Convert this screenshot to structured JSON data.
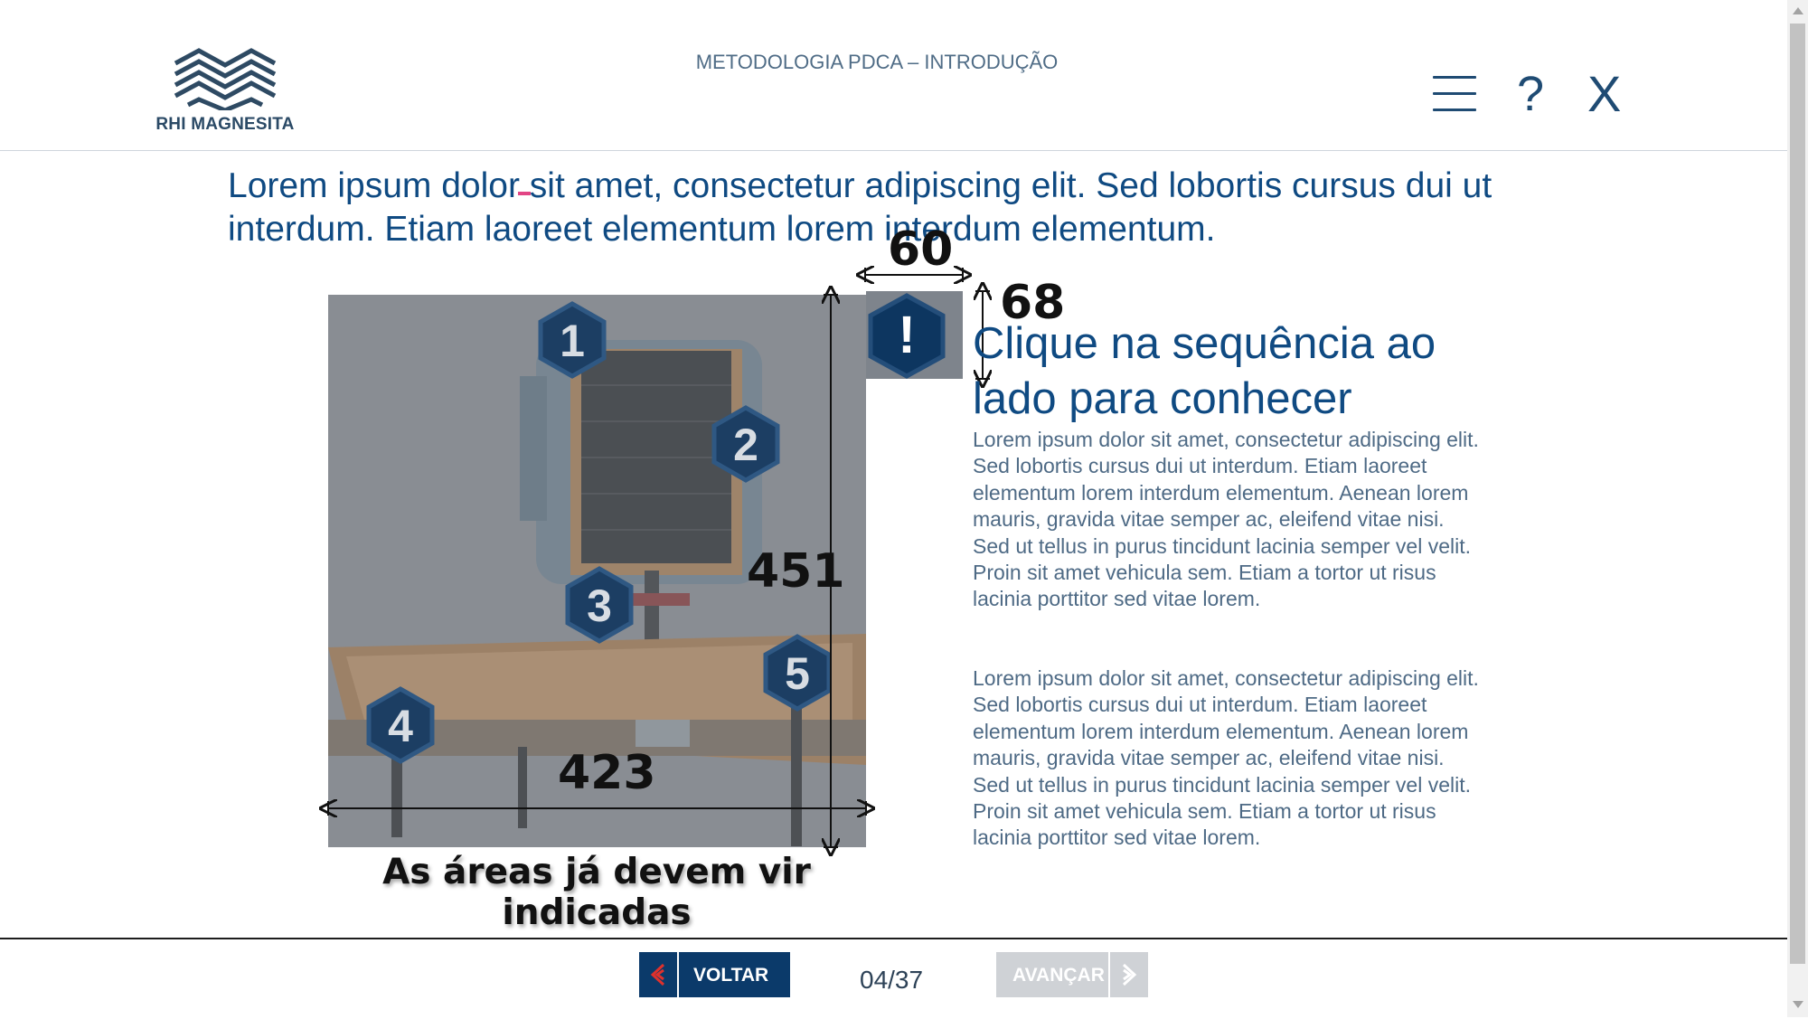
{
  "header": {
    "logo_text": "RHI MAGNESITA",
    "course_title": "METODOLOGIA PDCA – INTRODUÇÃO",
    "menu_icon": "hamburger-menu-icon",
    "help_label": "?",
    "close_label": "X"
  },
  "intro": {
    "text": "Lorem ipsum dolor sit amet, consectetur adipiscing elit. Sed lobortis cursus dui ut interdum. Etiam laoreet elementum lorem interdum elementum."
  },
  "illustration": {
    "markers": [
      {
        "label": "1"
      },
      {
        "label": "2"
      },
      {
        "label": "3"
      },
      {
        "label": "4"
      },
      {
        "label": "5"
      }
    ],
    "dimensions": {
      "top_width": "60",
      "right_height": "68",
      "image_height": "451",
      "image_width": "423"
    },
    "caption": "As áreas já devem vir indicadas",
    "alert_symbol": "!"
  },
  "content": {
    "title": "Clique na sequência ao lado para conhecer",
    "paragraph_1": "Lorem ipsum dolor sit amet, consectetur adipiscing elit. Sed lobortis cursus dui ut interdum. Etiam laoreet elementum lorem interdum elementum. Aenean lorem mauris, gravida vitae semper ac, eleifend vitae nisi. Sed ut tellus in purus tincidunt lacinia semper vel velit. Proin sit amet vehicula sem. Etiam a tortor ut risus lacinia porttitor sed vitae lorem.",
    "paragraph_2": "Lorem ipsum dolor sit amet, consectetur adipiscing elit. Sed lobortis cursus dui ut interdum. Etiam laoreet elementum lorem interdum elementum. Aenean lorem mauris, gravida vitae semper ac, eleifend vitae nisi. Sed ut tellus in purus tincidunt lacinia semper vel velit. Proin sit amet vehicula sem. Etiam a tortor ut risus lacinia porttitor sed vitae lorem."
  },
  "footer": {
    "back_label": "VOLTAR",
    "page_counter": "04/37",
    "next_label": "AVANÇAR"
  },
  "colors": {
    "brand_blue": "#0b3a6a",
    "title_blue": "#0f4a82",
    "back_arrow_red": "#e0312c",
    "disabled_gray": "#cfd2d6"
  }
}
